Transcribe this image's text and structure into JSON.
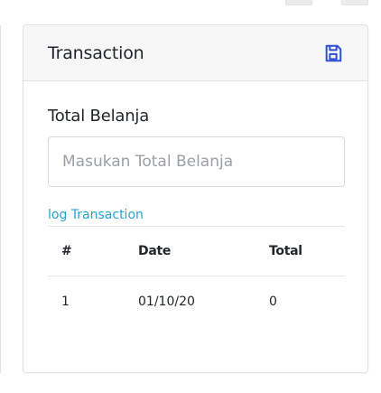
{
  "card": {
    "title": "Transaction",
    "save_icon": "save-icon",
    "accent_color": "#2f4fd6"
  },
  "form": {
    "label": "Total Belanja",
    "placeholder": "Masukan Total Belanja",
    "value": ""
  },
  "log": {
    "link_text": "log Transaction",
    "link_color": "#20a4d6"
  },
  "table": {
    "headers": [
      "#",
      "Date",
      "Total"
    ],
    "rows": [
      [
        "1",
        "01/10/20",
        "0"
      ]
    ]
  }
}
